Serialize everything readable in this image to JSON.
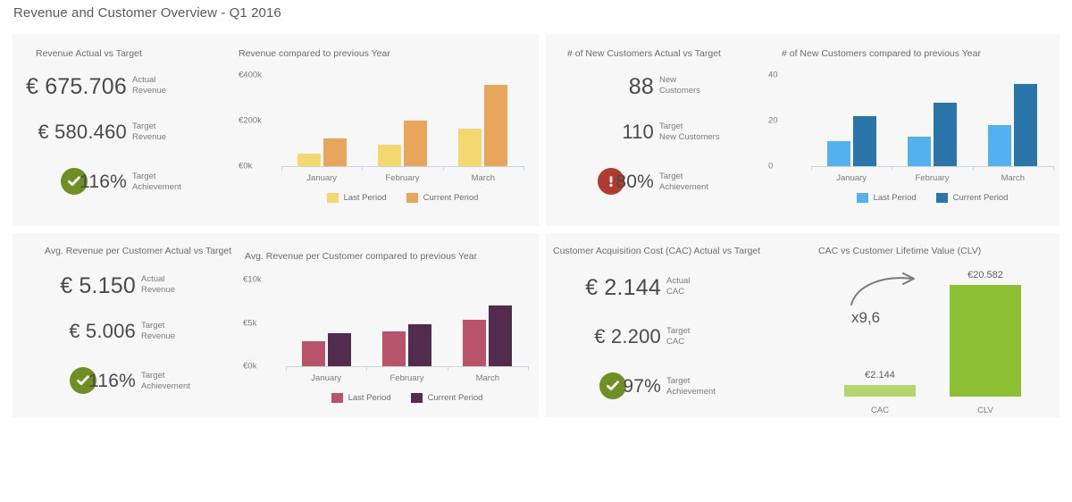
{
  "header": {
    "title": "Revenue and Customer Overview - Q1 2016"
  },
  "colors": {
    "panel_bg": "#f7f7f7",
    "page_bg": "#ffffff",
    "text": "#5a5a5a",
    "muted": "#7b7b7b",
    "axis": "#c9d5dd",
    "ok_green": "#6f8f22",
    "alert_red": "#b03a2e",
    "revenue_last": "#f3d86f",
    "revenue_current": "#e8a55c",
    "customers_last": "#53b1ef",
    "customers_current": "#2a75a9",
    "arpc_last": "#b8546a",
    "arpc_current": "#532b4e",
    "cac_bar": "#b5d66c",
    "clv_bar": "#8cbf31"
  },
  "panels": {
    "revenue": {
      "kpi_title": "Revenue Actual vs Target",
      "chart_title": "Revenue compared to previous Year",
      "kpis": [
        {
          "value": "€ 675.706",
          "label_line1": "Actual",
          "label_line2": "Revenue",
          "size": "big",
          "icon": "none"
        },
        {
          "value": "€ 580.460",
          "label_line1": "Target",
          "label_line2": "Revenue",
          "size": "mid",
          "icon": "none"
        },
        {
          "value": "116%",
          "label_line1": "Target",
          "label_line2": "Achievement",
          "size": "pct",
          "icon": "check-circle"
        }
      ]
    },
    "customers": {
      "kpi_title": "# of New Customers Actual vs Target",
      "chart_title": "# of New Customers compared to previous Year",
      "kpis": [
        {
          "value": "88",
          "label_line1": "New",
          "label_line2": "Customers",
          "size": "big",
          "icon": "none"
        },
        {
          "value": "110",
          "label_line1": "Target",
          "label_line2": "New Customers",
          "size": "mid",
          "icon": "none"
        },
        {
          "value": "80%",
          "label_line1": "Target",
          "label_line2": "Achievement",
          "size": "pct",
          "icon": "alert-circle"
        }
      ]
    },
    "arpc": {
      "kpi_title": "Avg. Revenue per Customer Actual vs Target",
      "chart_title": "Avg. Revenue per Customer compared to previous Year",
      "kpis": [
        {
          "value": "€ 5.150",
          "label_line1": "Actual",
          "label_line2": "Revenue",
          "size": "big",
          "icon": "none"
        },
        {
          "value": "€ 5.006",
          "label_line1": "Target",
          "label_line2": "Revenue",
          "size": "mid",
          "icon": "none"
        },
        {
          "value": "116%",
          "label_line1": "Target",
          "label_line2": "Achievement",
          "size": "pct",
          "icon": "check-circle"
        }
      ]
    },
    "cac": {
      "kpi_title": "Customer Acquisition Cost (CAC) Actual vs Target",
      "chart_title": "CAC vs Customer Lifetime Value (CLV)",
      "kpis": [
        {
          "value": "€ 2.144",
          "label_line1": "Actual",
          "label_line2": "CAC",
          "size": "big",
          "icon": "none"
        },
        {
          "value": "€ 2.200",
          "label_line1": "Target",
          "label_line2": "CAC",
          "size": "mid",
          "icon": "none"
        },
        {
          "value": "97%",
          "label_line1": "Target",
          "label_line2": "Achievement",
          "size": "pct",
          "icon": "check-circle"
        }
      ]
    }
  },
  "chart_data": [
    {
      "id": "revenue-chart",
      "type": "bar",
      "title": "Revenue compared to previous Year",
      "categories": [
        "January",
        "February",
        "March"
      ],
      "series": [
        {
          "name": "Last Period",
          "color": "#f3d86f",
          "values": [
            54000,
            93000,
            165000
          ]
        },
        {
          "name": "Current Period",
          "color": "#e8a55c",
          "values": [
            123000,
            199000,
            355000
          ]
        }
      ],
      "ylim": [
        0,
        400000
      ],
      "yticks": [
        0,
        200000,
        400000
      ],
      "ytick_labels": [
        "€0k",
        "€200k",
        "€400k"
      ],
      "xlabel": "",
      "ylabel": "",
      "grid": false,
      "legend_position": "bottom"
    },
    {
      "id": "customers-chart",
      "type": "bar",
      "title": "# of New Customers compared to previous Year",
      "categories": [
        "January",
        "February",
        "March"
      ],
      "series": [
        {
          "name": "Last Period",
          "color": "#53b1ef",
          "values": [
            11,
            13,
            18
          ]
        },
        {
          "name": "Current Period",
          "color": "#2a75a9",
          "values": [
            22,
            28,
            36
          ]
        }
      ],
      "ylim": [
        0,
        40
      ],
      "yticks": [
        0,
        20,
        40
      ],
      "ytick_labels": [
        "0",
        "20",
        "40"
      ],
      "xlabel": "",
      "ylabel": "",
      "grid": false,
      "legend_position": "bottom"
    },
    {
      "id": "arpc-chart",
      "type": "bar",
      "title": "Avg. Revenue per Customer compared to previous Year",
      "categories": [
        "January",
        "February",
        "March"
      ],
      "series": [
        {
          "name": "Last Period",
          "color": "#b8546a",
          "values": [
            2900,
            4000,
            5400
          ]
        },
        {
          "name": "Current Period",
          "color": "#532b4e",
          "values": [
            3800,
            4800,
            7000
          ]
        }
      ],
      "ylim": [
        0,
        10000
      ],
      "yticks": [
        0,
        5000,
        10000
      ],
      "ytick_labels": [
        "€0k",
        "€5k",
        "€10k"
      ],
      "xlabel": "",
      "ylabel": "",
      "grid": false,
      "legend_position": "bottom"
    },
    {
      "id": "cac-clv-chart",
      "type": "bar",
      "title": "CAC vs Customer Lifetime Value (CLV)",
      "categories": [
        "CAC",
        "CLV"
      ],
      "values": [
        2144,
        20582
      ],
      "value_labels": [
        "€2.144",
        "€20.582"
      ],
      "colors": [
        "#b5d66c",
        "#8cbf31"
      ],
      "annotation": "x9,6",
      "ylim": [
        0,
        20582
      ],
      "grid": false,
      "legend_position": "none"
    }
  ]
}
